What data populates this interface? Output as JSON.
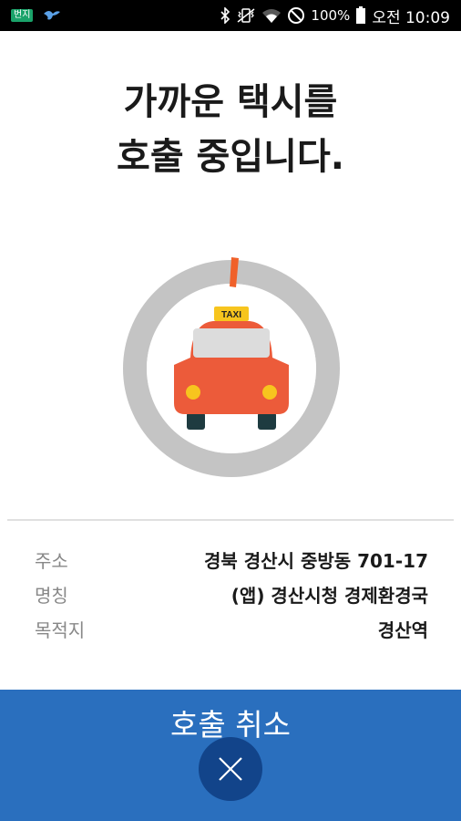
{
  "status_bar": {
    "notification_badge": "번지",
    "battery": "100%",
    "time": "오전 10:09"
  },
  "headline": {
    "line1": "가까운 택시를",
    "line2": "호출 중입니다."
  },
  "taxi_roof_sign": "TAXI",
  "details": {
    "address_label": "주소",
    "address_value": "경북 경산시 중방동 701-17",
    "name_label": "명칭",
    "name_value": "(앱) 경산시청 경제환경국",
    "destination_label": "목적지",
    "destination_value": "경산역"
  },
  "cancel": {
    "label": "호출 취소"
  },
  "colors": {
    "primary_blue": "#2a6fbe",
    "cancel_button": "#12448a",
    "taxi_body": "#ec5b3a",
    "progress_accent": "#f0612a",
    "ring_gray": "#c4c4c4"
  },
  "icons": [
    "bluetooth-icon",
    "vibrate-icon",
    "wifi-icon",
    "do-not-disturb-icon",
    "battery-icon",
    "close-icon"
  ]
}
